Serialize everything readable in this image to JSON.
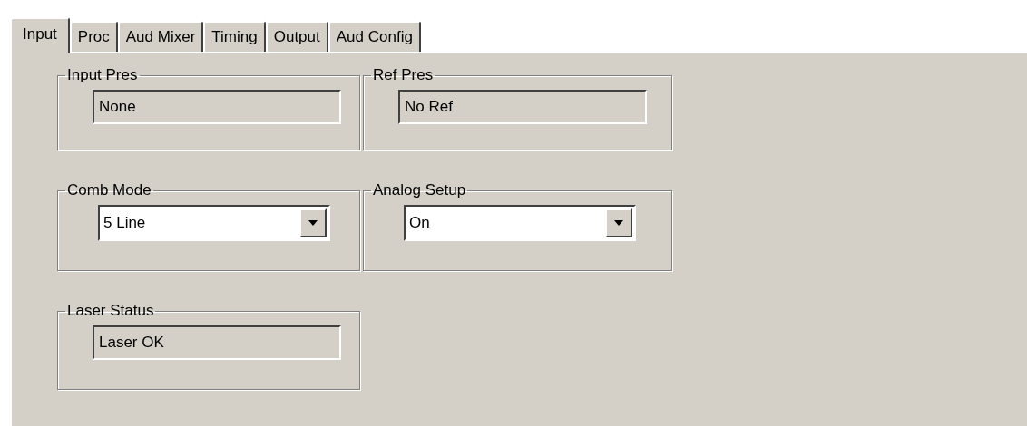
{
  "tabs": [
    {
      "label": "Input",
      "selected": true
    },
    {
      "label": "Proc",
      "selected": false
    },
    {
      "label": "Aud Mixer",
      "selected": false
    },
    {
      "label": "Timing",
      "selected": false
    },
    {
      "label": "Output",
      "selected": false
    },
    {
      "label": "Aud Config",
      "selected": false
    }
  ],
  "groups": [
    {
      "title": "Input Pres",
      "kind": "readout",
      "value": "None"
    },
    {
      "title": "Ref Pres",
      "kind": "readout",
      "value": "No Ref"
    },
    {
      "title": "Comb Mode",
      "kind": "dropdown",
      "value": "5 Line"
    },
    {
      "title": "Analog Setup",
      "kind": "dropdown",
      "value": "On"
    },
    {
      "title": "Laser Status",
      "kind": "readout",
      "value": "Laser OK"
    }
  ]
}
